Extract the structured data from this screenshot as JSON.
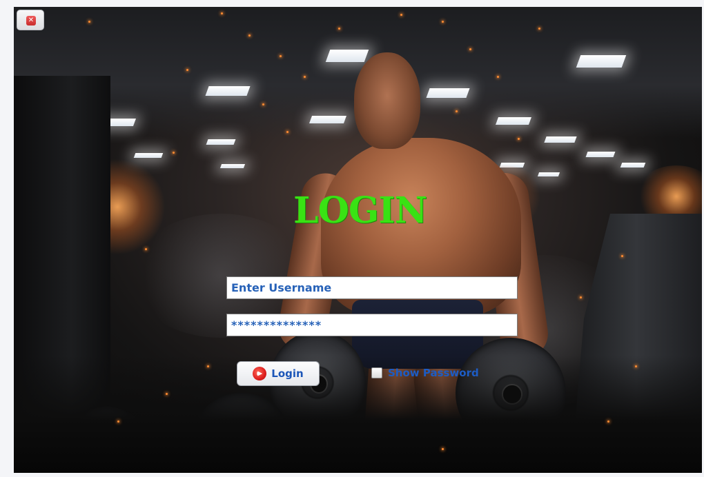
{
  "window": {
    "close_icon": "close-icon"
  },
  "title": "LOGIN",
  "form": {
    "username_value": "Enter Username",
    "password_value": "**************",
    "login_button_label": "Login",
    "login_icon": "login-arrow-icon",
    "show_password_label": "Show Password",
    "show_password_checked": false
  },
  "colors": {
    "title": "#39e214",
    "field_text": "#2762b8",
    "button_text": "#1c56b8",
    "checkbox_label": "#1d5cc4"
  }
}
